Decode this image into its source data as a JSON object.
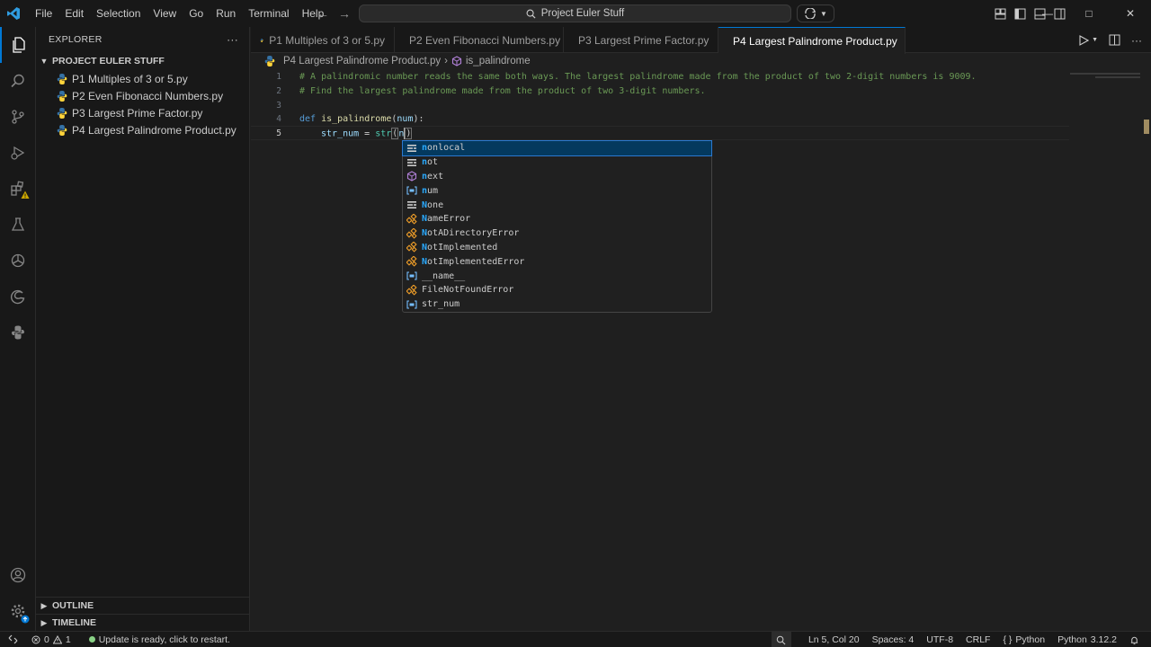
{
  "titlebar": {
    "menu": [
      "File",
      "Edit",
      "Selection",
      "View",
      "Go",
      "Run",
      "Terminal",
      "Help"
    ],
    "search_text": "Project Euler Stuff"
  },
  "sidebar": {
    "title": "EXPLORER",
    "more": "···",
    "project": "PROJECT EULER STUFF",
    "files": [
      "P1 Multiples of 3 or 5.py",
      "P2 Even Fibonacci Numbers.py",
      "P3 Largest Prime Factor.py",
      "P4 Largest Palindrome Product.py"
    ],
    "outline": "OUTLINE",
    "timeline": "TIMELINE"
  },
  "tabs": [
    {
      "label": "P1 Multiples of 3 or 5.py"
    },
    {
      "label": "P2 Even Fibonacci Numbers.py"
    },
    {
      "label": "P3 Largest Prime Factor.py"
    },
    {
      "label": "P4 Largest Palindrome Product.py"
    }
  ],
  "breadcrumb": {
    "file": "P4 Largest Palindrome Product.py",
    "separator": "›",
    "symbol": "is_palindrome"
  },
  "editor": {
    "line_numbers": [
      "1",
      "2",
      "3",
      "4",
      "5"
    ],
    "line1": "# A palindromic number reads the same both ways. The largest palindrome made from the product of two 2-digit numbers is 9009.",
    "line2": "# Find the largest palindrome made from the product of two 3-digit numbers.",
    "line4_kw": "def",
    "line4_fn": "is_palindrome",
    "line4_open": "(",
    "line4_param": "num",
    "line4_close": "):",
    "line5_var": "str_num",
    "line5_eq": " = ",
    "line5_fn": "str",
    "line5_open": "(",
    "line5_typed": "n",
    "line5_close": ")"
  },
  "suggestions": [
    {
      "match": "n",
      "rest": "onlocal",
      "icon": "keyword-icon"
    },
    {
      "match": "n",
      "rest": "ot",
      "icon": "keyword-icon"
    },
    {
      "match": "n",
      "rest": "ext",
      "icon": "function-icon"
    },
    {
      "match": "n",
      "rest": "um",
      "icon": "variable-icon"
    },
    {
      "match": "N",
      "rest": "one",
      "icon": "keyword-icon"
    },
    {
      "match": "N",
      "rest": "ameError",
      "icon": "class-icon"
    },
    {
      "match": "N",
      "rest": "otADirectoryError",
      "icon": "class-icon"
    },
    {
      "match": "N",
      "rest": "otImplemented",
      "icon": "class-icon"
    },
    {
      "match": "N",
      "rest": "otImplementedError",
      "icon": "class-icon"
    },
    {
      "match": "",
      "rest": "__name__",
      "icon": "variable-icon"
    },
    {
      "match": "",
      "rest": "FileNotFoundError",
      "icon": "class-icon"
    },
    {
      "match": "",
      "rest": "str_num",
      "icon": "variable-icon"
    }
  ],
  "statusbar": {
    "errors": "0",
    "warnings": "1",
    "update": "Update is ready, click to restart.",
    "position": "Ln 5, Col 20",
    "spaces": "Spaces: 4",
    "encoding": "UTF-8",
    "eol": "CRLF",
    "language": "Python",
    "interpreter": "3.12.2"
  },
  "colors": {
    "accent": "#0078d4",
    "python_blue": "#3572a5",
    "python_yellow": "#ffd43b",
    "warning": "#cca700"
  }
}
